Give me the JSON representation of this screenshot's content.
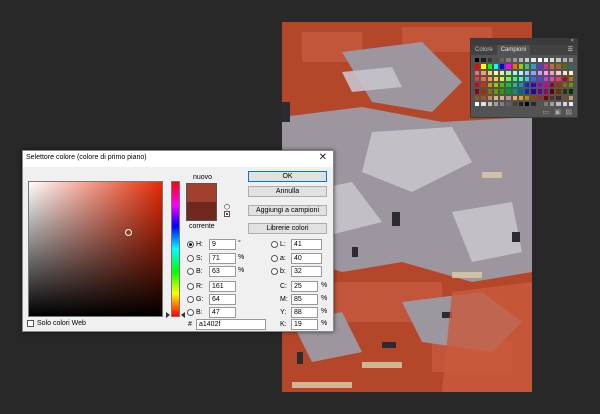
{
  "colors": {
    "new": "#a1402f",
    "current": "#71281e",
    "rug_base": "#b4472a",
    "rug_gray": "#9c9ba6",
    "rug_light": "#c7c4cb",
    "rug_dark": "#2b2b30",
    "rug_cream": "#d8c8a8"
  },
  "swatches_panel": {
    "tabs": [
      {
        "label": "Colore",
        "active": false
      },
      {
        "label": "Campioni",
        "active": true
      }
    ],
    "collapse_icon": "double-chevron-icon",
    "menu_icon": "panel-menu-icon",
    "footer_icons": [
      "new-folder-icon",
      "new-swatch-icon",
      "trash-icon"
    ],
    "swatch_colors": [
      "#000000",
      "#1a1a1a",
      "#333333",
      "#4d4d4d",
      "#666666",
      "#808080",
      "#999999",
      "#b3b3b3",
      "#cccccc",
      "#e6e6e6",
      "#ffffff",
      "#f0f0f0",
      "#dcdcdc",
      "#c8c8c8",
      "#b4b4b4",
      "#a0a0a0",
      "#ff0000",
      "#ffff00",
      "#00ff00",
      "#00ffff",
      "#0000ff",
      "#ff00ff",
      "#ff6600",
      "#99cc00",
      "#33cc66",
      "#3399cc",
      "#6633cc",
      "#cc3399",
      "#cc6633",
      "#996633",
      "#666600",
      "#336666",
      "#ff6666",
      "#ff9966",
      "#ffcc66",
      "#ffff99",
      "#ccff99",
      "#99ff99",
      "#99ffcc",
      "#99ffff",
      "#99ccff",
      "#9999ff",
      "#cc99ff",
      "#ff99ff",
      "#ff99cc",
      "#ffcccc",
      "#ffe5cc",
      "#fff2cc",
      "#ff3333",
      "#ff6633",
      "#ff9933",
      "#ffcc33",
      "#ccff33",
      "#66ff33",
      "#33ff66",
      "#33ffcc",
      "#33ccff",
      "#3366ff",
      "#6633ff",
      "#cc33ff",
      "#ff33cc",
      "#ff3366",
      "#cc0000",
      "#cc6600",
      "#cc0033",
      "#cc3300",
      "#cc9900",
      "#99cc00",
      "#33cc00",
      "#00cc33",
      "#00cc99",
      "#0099cc",
      "#0033cc",
      "#3300cc",
      "#9900cc",
      "#cc0099",
      "#990033",
      "#993300",
      "#996600",
      "#669900",
      "#990000",
      "#993300",
      "#996600",
      "#669900",
      "#339900",
      "#009933",
      "#009966",
      "#006699",
      "#003399",
      "#330099",
      "#660099",
      "#990066",
      "#660000",
      "#663300",
      "#333300",
      "#003300",
      "#8b5a2b",
      "#a0522d",
      "#cd853f",
      "#deb887",
      "#d2b48c",
      "#bc8f8f",
      "#f4a460",
      "#daa520",
      "#b8860b",
      "#8b4513",
      "#a52a2a",
      "#800000",
      "#4b3621",
      "#3d2b1f",
      "#6f4e37",
      "#c19a6b",
      "#ffffff",
      "#e0e0e0",
      "#c0c0c0",
      "#a0a0a0",
      "#808080",
      "#606060",
      "#404040",
      "#202020",
      "#000000",
      "#2b2b2b",
      "#555555",
      "#7a7a7a",
      "#9e9e9e",
      "#bdbdbd",
      "#d4d4d4",
      "#ececec"
    ]
  },
  "dialog": {
    "title": "Selettore colore (colore di primo piano)",
    "close_icon": "close-icon",
    "label_new": "nuovo",
    "label_current": "corrente",
    "buttons": {
      "ok": "OK",
      "cancel": "Annulla",
      "add_swatches": "Aggiungi a campioni",
      "libraries": "Librerie colori"
    },
    "hsb": [
      {
        "label": "H:",
        "value": "9",
        "unit": "°",
        "selected": true
      },
      {
        "label": "S:",
        "value": "71",
        "unit": "%",
        "selected": false
      },
      {
        "label": "B:",
        "value": "63",
        "unit": "%",
        "selected": false
      }
    ],
    "rgb": [
      {
        "label": "R:",
        "value": "161"
      },
      {
        "label": "G:",
        "value": "64"
      },
      {
        "label": "B:",
        "value": "47"
      }
    ],
    "lab": [
      {
        "label": "L:",
        "value": "41"
      },
      {
        "label": "a:",
        "value": "40"
      },
      {
        "label": "b:",
        "value": "32"
      }
    ],
    "cmyk": [
      {
        "label": "C:",
        "value": "25",
        "unit": "%"
      },
      {
        "label": "M:",
        "value": "85",
        "unit": "%"
      },
      {
        "label": "Y:",
        "value": "88",
        "unit": "%"
      },
      {
        "label": "K:",
        "value": "19",
        "unit": "%"
      }
    ],
    "hex_label": "#",
    "hex_value": "a1402f",
    "websafe_label": "Solo colori Web"
  }
}
